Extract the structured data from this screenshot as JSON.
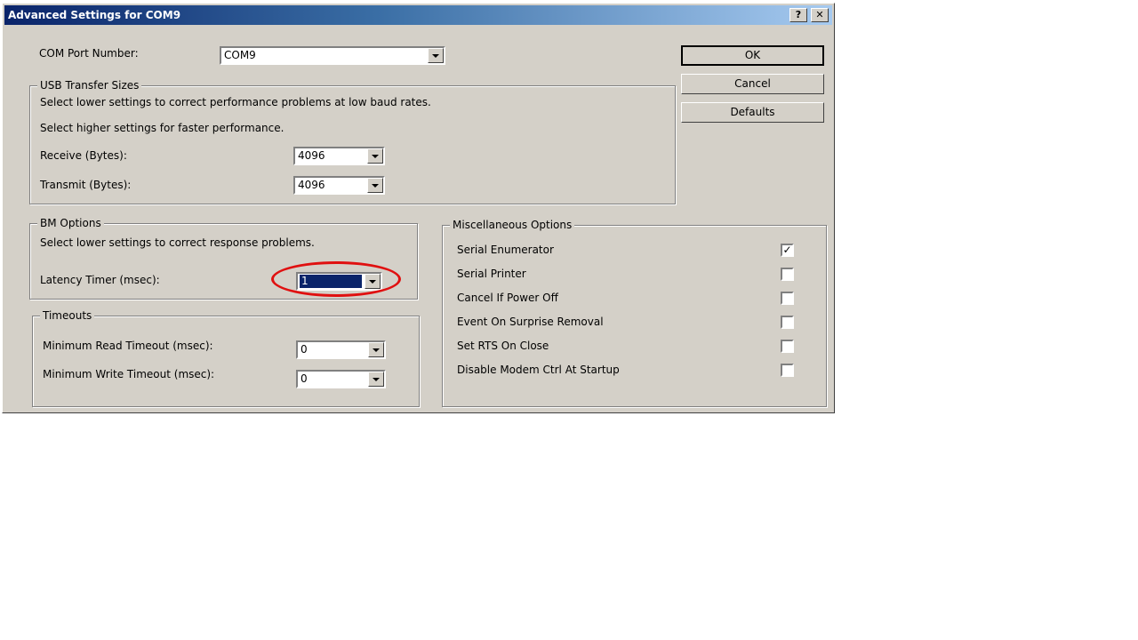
{
  "window": {
    "title": "Advanced Settings for COM9",
    "help_btn": "?",
    "close_btn": "✕"
  },
  "com_port": {
    "label": "COM Port Number:",
    "value": "COM9"
  },
  "usb": {
    "legend": "USB Transfer Sizes",
    "line1": "Select lower settings to correct performance problems at low baud rates.",
    "line2": "Select higher settings for faster performance.",
    "receive_label": "Receive (Bytes):",
    "receive_value": "4096",
    "transmit_label": "Transmit (Bytes):",
    "transmit_value": "4096"
  },
  "bm": {
    "legend": "BM Options",
    "line1": "Select lower settings to correct response problems.",
    "latency_label": "Latency Timer (msec):",
    "latency_value": "1"
  },
  "timeouts": {
    "legend": "Timeouts",
    "read_label": "Minimum Read Timeout (msec):",
    "read_value": "0",
    "write_label": "Minimum Write Timeout (msec):",
    "write_value": "0"
  },
  "misc": {
    "legend": "Miscellaneous Options",
    "items": [
      {
        "label": "Serial Enumerator",
        "checked": true
      },
      {
        "label": "Serial Printer",
        "checked": false
      },
      {
        "label": "Cancel If Power Off",
        "checked": false
      },
      {
        "label": "Event On Surprise Removal",
        "checked": false
      },
      {
        "label": "Set RTS On Close",
        "checked": false
      },
      {
        "label": "Disable Modem Ctrl At Startup",
        "checked": false
      }
    ],
    "check_glyph": "✓"
  },
  "buttons": {
    "ok": "OK",
    "cancel": "Cancel",
    "defaults": "Defaults"
  },
  "colors": {
    "highlight_ring": "#e01010",
    "title_bar": "#0a246a",
    "dialog_bg": "#d4d0c8"
  }
}
